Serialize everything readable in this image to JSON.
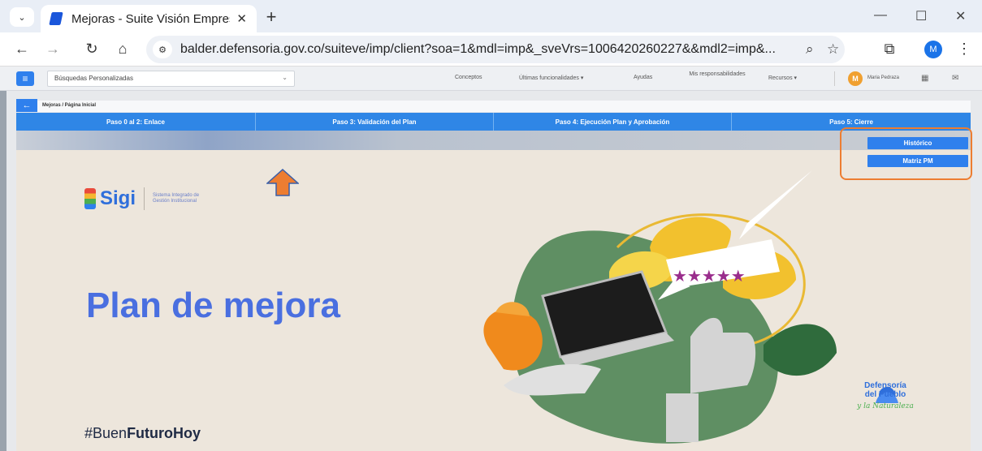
{
  "browser": {
    "tab_title": "Mejoras - Suite Visión Empresa",
    "url": "balder.defensoria.gov.co/suiteve/imp/client?soa=1&mdl=imp&_sveVrs=1006420260227&&mdl2=imp&...",
    "profile_initial": "M"
  },
  "appbar": {
    "search_select": "Búsquedas Personalizadas",
    "menu": [
      "Conceptos",
      "Últimas funcionalidades",
      "Ayudas",
      "Mis responsabilidades",
      "Recursos"
    ],
    "user_initial": "M",
    "user_name": "Maria Pedraza"
  },
  "page": {
    "breadcrumb": "Mejoras / Página Inicial",
    "steps": [
      "Paso 0 al 2: Enlace",
      "Paso 3: Validación del Plan",
      "Paso 4: Ejecución Plan y Aprobación",
      "Paso 5: Cierre"
    ],
    "buttons": {
      "historico": "Histórico",
      "matriz": "Matriz PM"
    }
  },
  "banner": {
    "logo_word": "Sigi",
    "logo_desc": "Sistema Integrado de Gestión Institucional",
    "title": "Plan de mejora",
    "hashtag_pre": "#Buen",
    "hashtag_bold": "FuturoHoy",
    "org_line1": "Defensoría",
    "org_line2": "del Pueblo",
    "org_sub": "y la Naturaleza"
  },
  "colors": {
    "accent": "#2f80ed",
    "highlight": "#ed7d31",
    "title": "#4a6fe0"
  }
}
